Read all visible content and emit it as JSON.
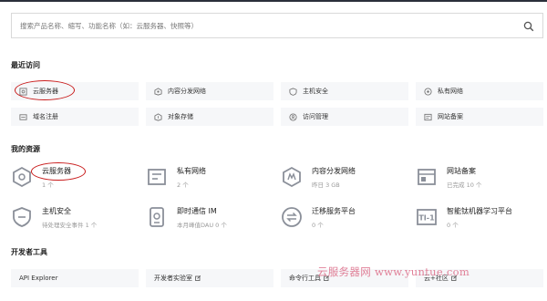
{
  "search": {
    "placeholder": "搜索产品名称、缩写、功能名称（如：云服务器、快照等）",
    "value": ""
  },
  "recent": {
    "title": "最近访问",
    "items": [
      {
        "label": "云服务器",
        "icon": "cloud-server-icon"
      },
      {
        "label": "内容分发网络",
        "icon": "cdn-icon"
      },
      {
        "label": "主机安全",
        "icon": "shield-icon"
      },
      {
        "label": "私有网络",
        "icon": "vpc-icon"
      },
      {
        "label": "域名注册",
        "icon": "domain-icon"
      },
      {
        "label": "对象存储",
        "icon": "storage-icon"
      },
      {
        "label": "访问管理",
        "icon": "access-icon"
      },
      {
        "label": "网站备案",
        "icon": "filing-icon"
      }
    ]
  },
  "resources": {
    "title": "我的资源",
    "items": [
      {
        "name": "云服务器",
        "sub": "1 个",
        "icon": "cloud-server-icon"
      },
      {
        "name": "私有网络",
        "sub": "2 个",
        "icon": "vpc-icon"
      },
      {
        "name": "内容分发网络",
        "sub": "昨日 3 GB",
        "icon": "cdn-icon"
      },
      {
        "name": "网站备案",
        "sub": "已完成 10 个",
        "icon": "filing-icon"
      },
      {
        "name": "主机安全",
        "sub": "待处理安全事件 1 个",
        "icon": "shield-icon"
      },
      {
        "name": "即时通信 IM",
        "sub": "本月峰值DAU 0 个",
        "icon": "im-icon"
      },
      {
        "name": "迁移服务平台",
        "sub": "0 个",
        "icon": "migration-icon"
      },
      {
        "name": "智能钛机器学习平台",
        "sub": "0 个",
        "icon": "ti-icon"
      }
    ]
  },
  "dev": {
    "title": "开发者工具",
    "items": [
      {
        "label": "API Explorer",
        "external": false
      },
      {
        "label": "开发者实验室",
        "external": true
      },
      {
        "label": "命令行工具",
        "external": true
      },
      {
        "label": "云+社区",
        "external": true
      }
    ]
  },
  "watermark": "云服务器网 www.yuntue.com",
  "colors": {
    "accent": "#c81b1b",
    "watermark": "#e08098",
    "tile_bg": "#f6f7f9"
  }
}
